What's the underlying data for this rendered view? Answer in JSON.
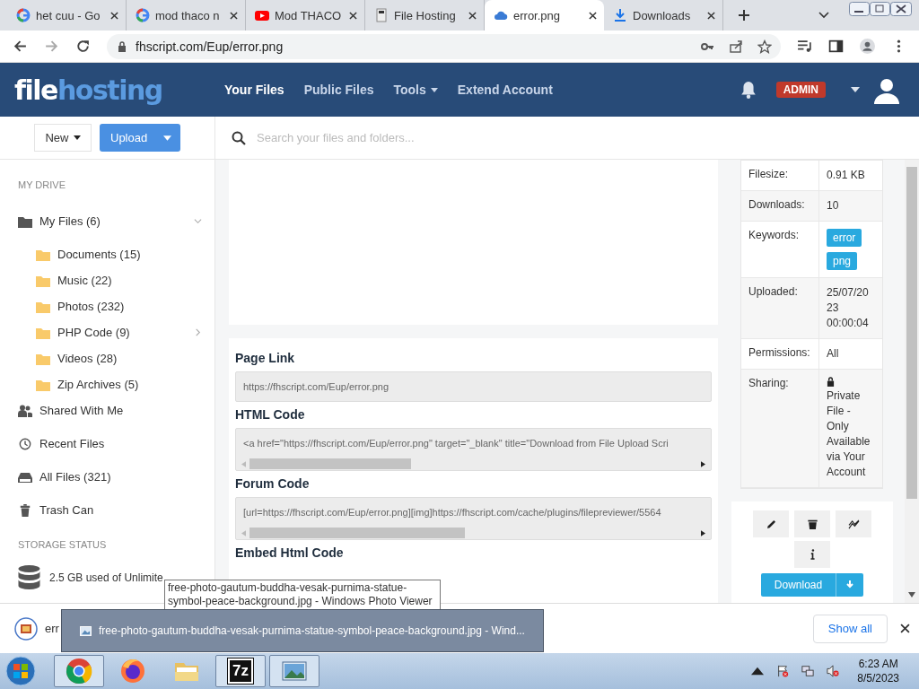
{
  "browser": {
    "tabs": [
      {
        "title": "het cuu - Go",
        "kind": "google",
        "selected": false
      },
      {
        "title": "mod thaco n",
        "kind": "google",
        "selected": false
      },
      {
        "title": "Mod THACO",
        "kind": "video",
        "selected": false
      },
      {
        "title": "File Hosting",
        "kind": "page",
        "selected": false
      },
      {
        "title": "error.png",
        "kind": "cloud",
        "selected": true
      },
      {
        "title": "Downloads",
        "kind": "download",
        "selected": false
      }
    ],
    "address": "fhscript.com/Eup/error.png"
  },
  "site": {
    "logo_left": "file",
    "logo_right": "hosting",
    "nav": [
      {
        "label": "Your Files",
        "selected": true,
        "dropdown": false
      },
      {
        "label": "Public Files",
        "selected": false,
        "dropdown": false
      },
      {
        "label": "Tools",
        "selected": false,
        "dropdown": true
      },
      {
        "label": "Extend Account",
        "selected": false,
        "dropdown": false
      }
    ],
    "badge": "ADMIN"
  },
  "toolbar": {
    "new": "New",
    "upload": "Upload",
    "search_placeholder": "Search your files and folders..."
  },
  "sidebar": {
    "heading": "MY DRIVE",
    "items": [
      {
        "label": "My Files (6)",
        "kind": "folder",
        "expanded": true,
        "children": [
          {
            "label": "Documents (15)",
            "kind": "folder"
          },
          {
            "label": "Music (22)",
            "kind": "folder"
          },
          {
            "label": "Photos (232)",
            "kind": "folder"
          },
          {
            "label": "PHP Code (9)",
            "kind": "folder",
            "expanded": false
          },
          {
            "label": "Videos (28)",
            "kind": "folder"
          },
          {
            "label": "Zip Archives (5)",
            "kind": "folder"
          }
        ]
      },
      {
        "label": "Shared With Me",
        "kind": "people"
      },
      {
        "label": "Recent Files",
        "kind": "clock"
      },
      {
        "label": "All Files (321)",
        "kind": "drive"
      },
      {
        "label": "Trash Can",
        "kind": "trash"
      }
    ],
    "storage_heading": "STORAGE STATUS",
    "storage_text": "2.5 GB used of Unlimite"
  },
  "codes": [
    {
      "label": "Page Link",
      "value": "https://fhscript.com/Eup/error.png",
      "scrollable": false
    },
    {
      "label": "HTML Code",
      "value": "<a href=\"https://fhscript.com/Eup/error.png\" target=\"_blank\" title=\"Download from File Upload Scri",
      "scrollable": true
    },
    {
      "label": "Forum Code",
      "value": "[url=https://fhscript.com/Eup/error.png][img]https://fhscript.com/cache/plugins/filepreviewer/5564",
      "scrollable": true
    },
    {
      "label": "Embed Html Code"
    }
  ],
  "details": [
    {
      "label": "Filesize:",
      "value": "0.91 KB"
    },
    {
      "label": "Downloads:",
      "value": "10"
    },
    {
      "label": "Keywords:",
      "tags": [
        "error",
        "png"
      ]
    },
    {
      "label": "Uploaded:",
      "value": "25/07/2023 00:00:04"
    },
    {
      "label": "Permissions:",
      "value": "All"
    },
    {
      "label": "Sharing:",
      "value": "Private File - Only Available via Your Account",
      "locked": true
    }
  ],
  "actions": {
    "download": "Download"
  },
  "downloads_bar": {
    "item": "err",
    "show_all": "Show all"
  },
  "tooltip": "free-photo-gautum-buddha-vesak-purnima-statue-symbol-peace-background.jpg - Windows Photo Viewer",
  "thumbnail_title": "free-photo-gautum-buddha-vesak-purnima-statue-symbol-peace-background.jpg - Wind...",
  "taskbar": {
    "apps": [
      {
        "kind": "chrome",
        "selected": true
      },
      {
        "kind": "firefox",
        "selected": false
      },
      {
        "kind": "explorer",
        "selected": false
      },
      {
        "kind": "archiver",
        "label": "7z",
        "selected": true
      },
      {
        "kind": "photos",
        "selected": true
      }
    ],
    "time": "6:23 AM",
    "date": "8/5/2023"
  }
}
